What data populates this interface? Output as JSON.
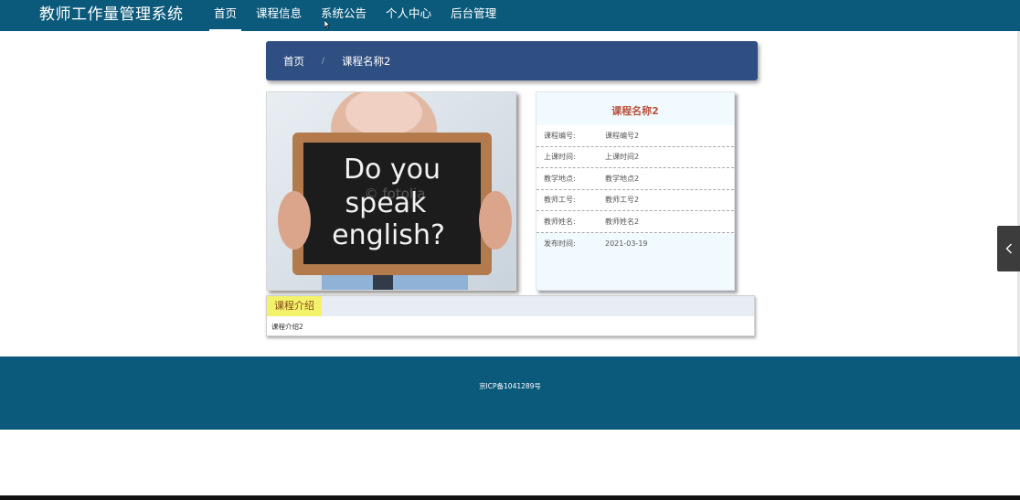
{
  "header": {
    "brand": "教师工作量管理系统",
    "nav": [
      {
        "label": "首页",
        "active": true
      },
      {
        "label": "课程信息",
        "active": false
      },
      {
        "label": "系统公告",
        "active": false
      },
      {
        "label": "个人中心",
        "active": false
      },
      {
        "label": "后台管理",
        "active": false
      }
    ]
  },
  "breadcrumb": {
    "home": "首页",
    "separator": "/",
    "current": "课程名称2"
  },
  "hero": {
    "line1": "Do you",
    "line2": "speak",
    "line3": "english?",
    "watermark": "© fotolia"
  },
  "detail": {
    "title": "课程名称2",
    "rows": [
      {
        "label": "课程编号:",
        "value": "课程编号2"
      },
      {
        "label": "上课时间:",
        "value": "上课时间2"
      },
      {
        "label": "教学地点:",
        "value": "教学地点2"
      },
      {
        "label": "教师工号:",
        "value": "教师工号2"
      },
      {
        "label": "教师姓名:",
        "value": "教师姓名2"
      },
      {
        "label": "发布时间:",
        "value": "2021-03-19"
      }
    ]
  },
  "intro": {
    "tab": "课程介绍",
    "content": "课程介绍2"
  },
  "side_tab": {
    "icon": "chevron-left-icon"
  },
  "footer": {
    "icp": "京ICP备1041289号"
  },
  "colors": {
    "nav_bg": "#0b5a7b",
    "breadcrumb_bg": "#2f4f82",
    "title_accent": "#b8533d",
    "tab_highlight": "#f3f36b"
  }
}
